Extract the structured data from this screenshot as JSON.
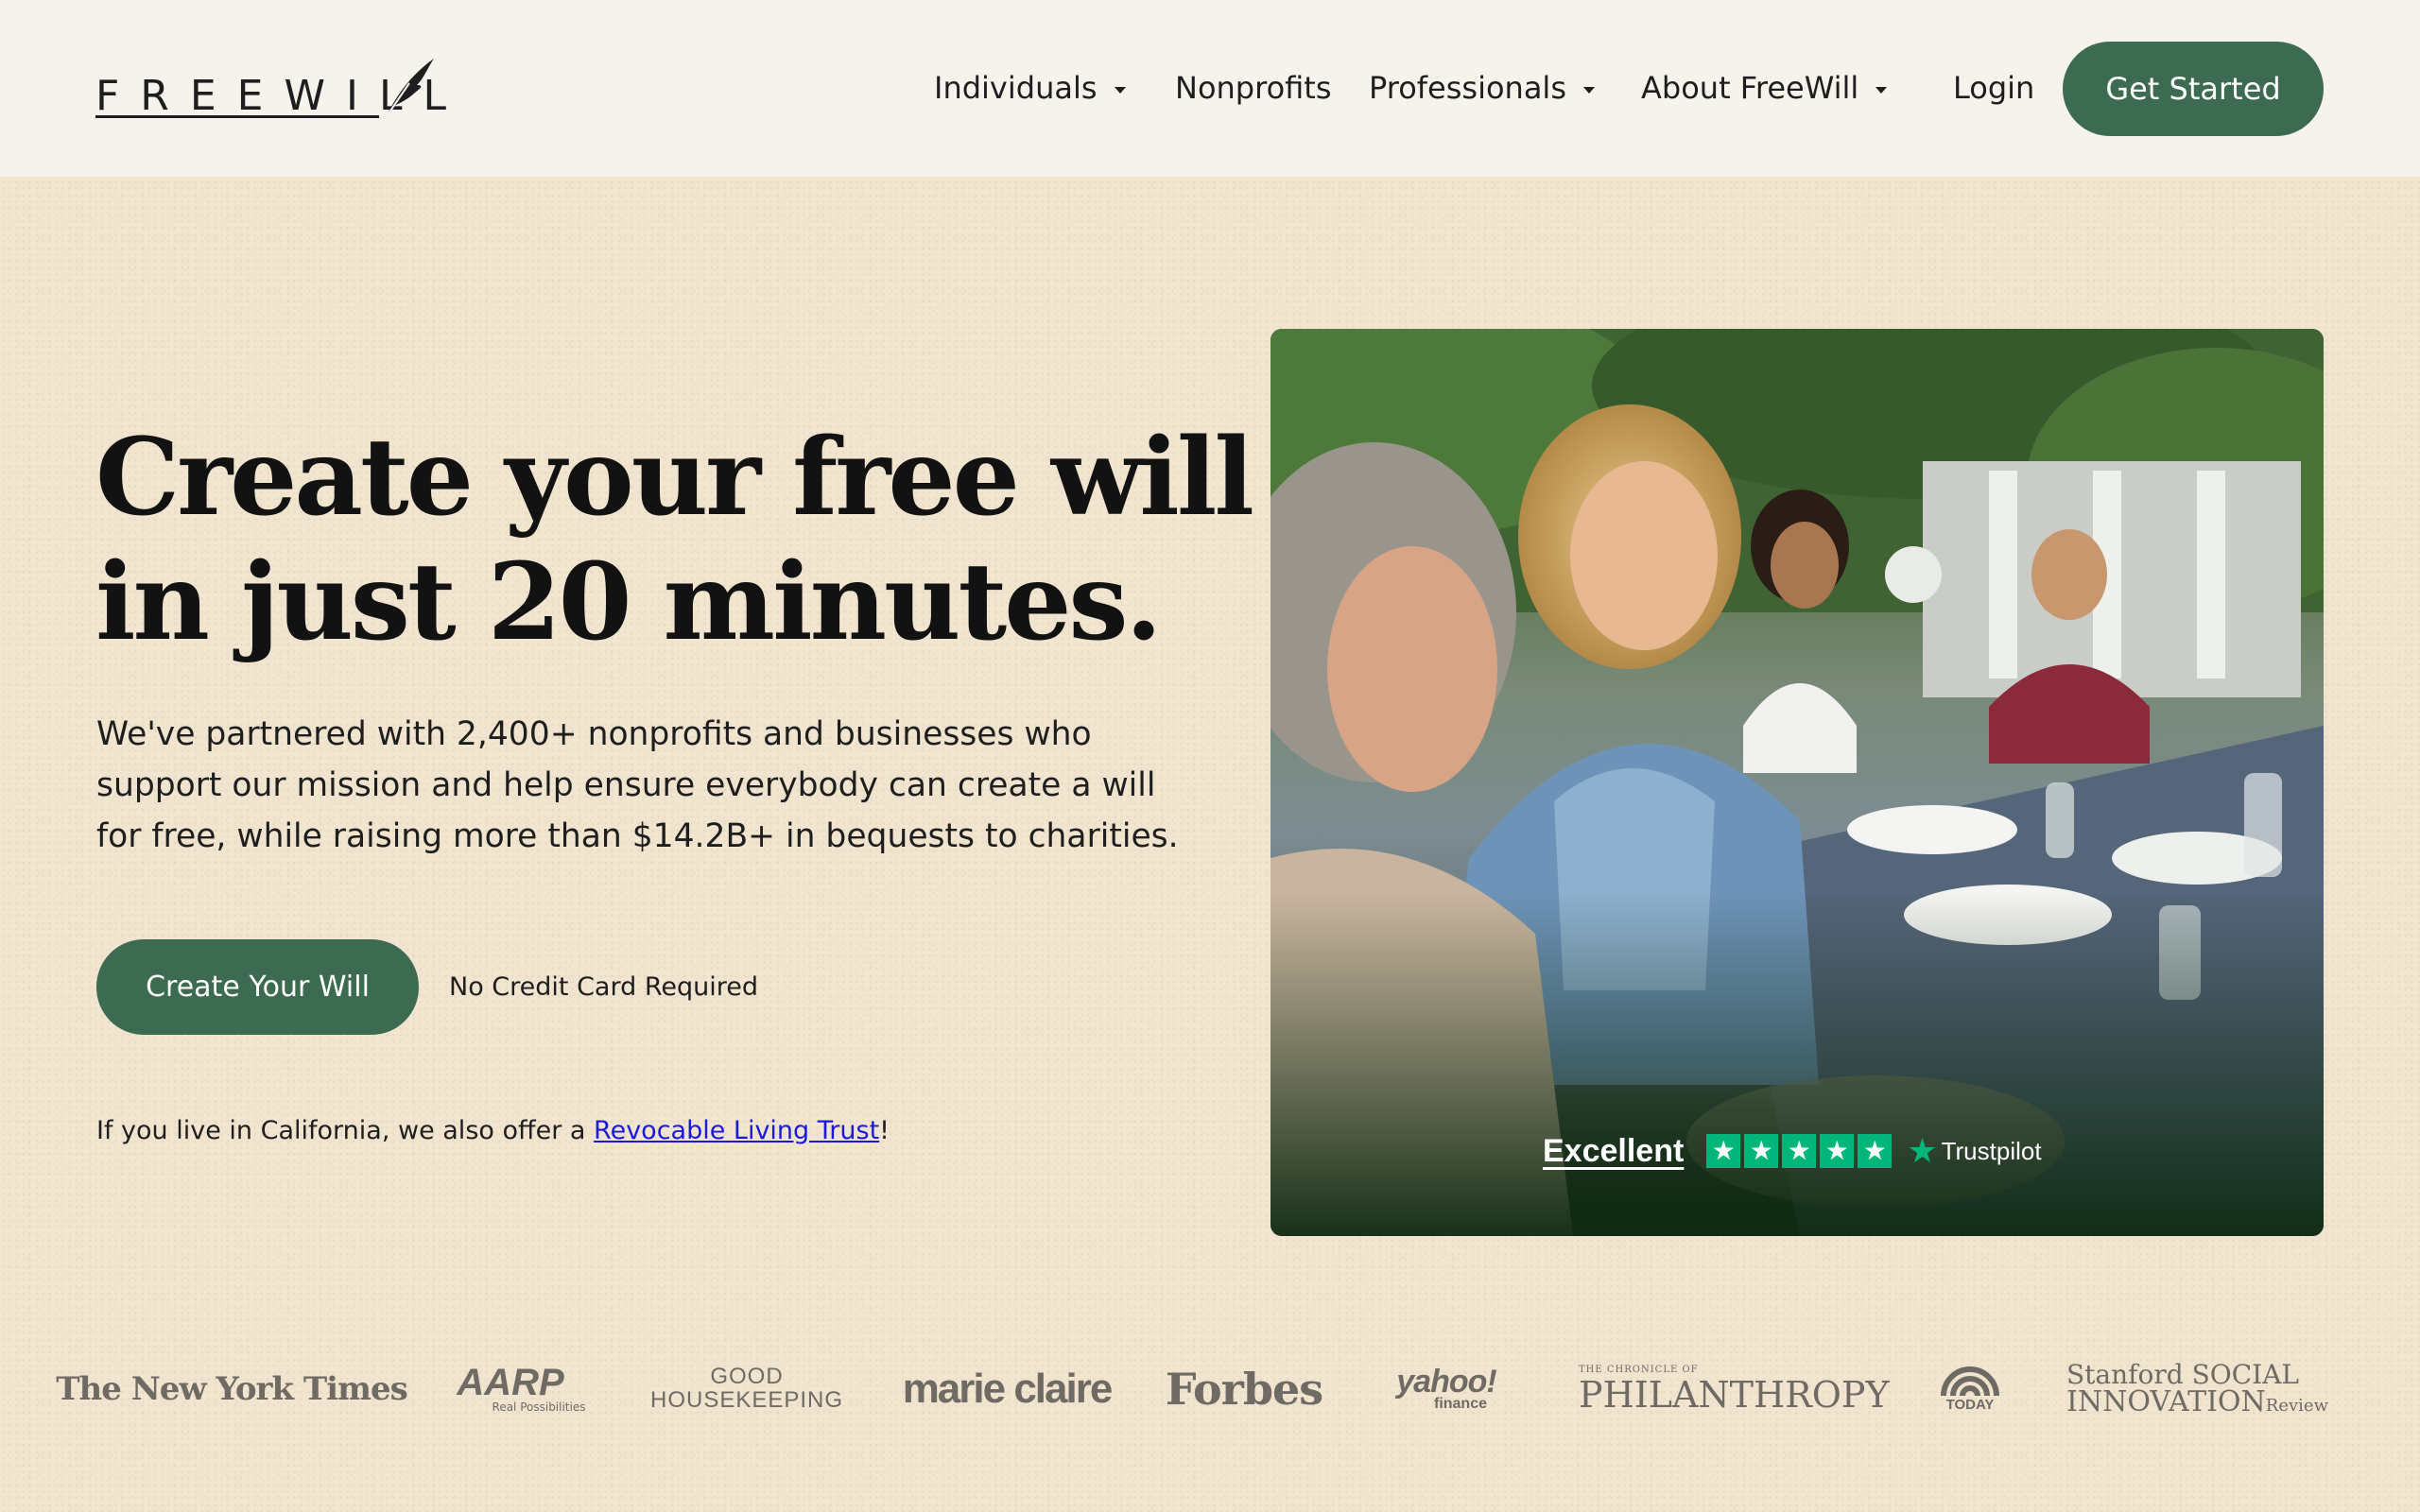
{
  "header": {
    "logo_text": "FREEWILL",
    "nav": [
      {
        "label": "Individuals",
        "has_dropdown": true
      },
      {
        "label": "Nonprofits",
        "has_dropdown": false
      },
      {
        "label": "Professionals",
        "has_dropdown": true
      },
      {
        "label": "About FreeWill",
        "has_dropdown": true
      }
    ],
    "login_label": "Login",
    "cta_label": "Get Started"
  },
  "hero": {
    "title_lines": [
      "Create your free will",
      "in just 20 minutes."
    ],
    "body_lines": [
      "We've partnered with 2,400+ nonprofits and businesses who",
      "support our mission and help ensure everybody can create a will",
      "for free, while raising more than $14.2B+ in bequests to charities."
    ],
    "cta_label": "Create Your Will",
    "cta_note": "No Credit Card Required",
    "california_prefix": "If you live in California, we also offer a ",
    "california_link": "Revocable Living Trust",
    "california_suffix": "!"
  },
  "trustpilot": {
    "rating_label": "Excellent",
    "stars": 5,
    "brand": "Trustpilot"
  },
  "press": [
    "The New York Times",
    "AARP",
    "Real Possibilities",
    "GOOD",
    "HOUSEKEEPING",
    "marie claire",
    "Forbes",
    "yahoo!",
    "finance",
    "THE CHRONICLE OF",
    "PHILANTHROPY",
    "TODAY",
    "Stanford SOCIAL",
    "INNOVATION",
    "Review"
  ],
  "colors": {
    "brand_green": "#3d6b52",
    "header_bg": "#f5f3ec",
    "page_bg": "#f1e5d0",
    "link": "#1a1add",
    "trustpilot_green": "#00b67a",
    "press_gray": "#6f6a63"
  },
  "icons": {
    "logo_mark": "feather-quill-icon",
    "dropdown": "caret-down-icon",
    "trustpilot_star": "star-icon"
  }
}
